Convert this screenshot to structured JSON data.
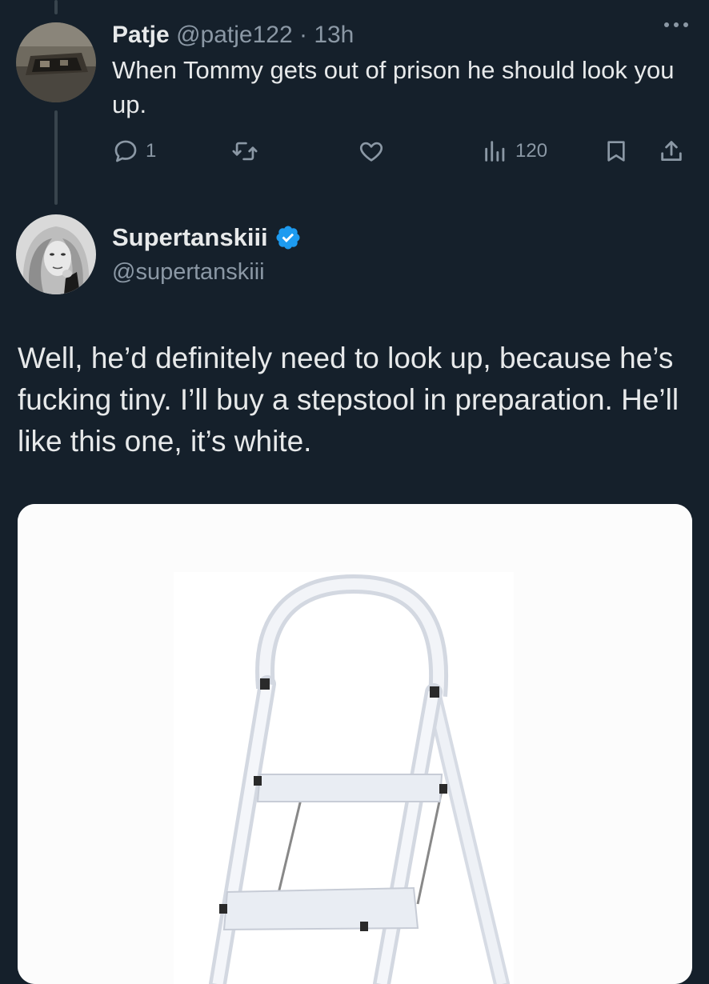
{
  "reply": {
    "display_name": "Patje",
    "handle": "@patje122",
    "separator": "·",
    "time": "13h",
    "text": "When Tommy gets out of prison he should look you up.",
    "reply_count": "1",
    "views": "120"
  },
  "tweet": {
    "display_name": "Supertanskiii",
    "handle": "@supertanskiii",
    "verified": true,
    "text": "Well, he’d definitely need to look up, because he’s fucking tiny. I’ll buy a stepstool in preparation. He’ll like this one, it’s white."
  },
  "icons": [
    "more-icon",
    "reply-icon",
    "retweet-icon",
    "like-icon",
    "views-icon",
    "bookmark-icon",
    "share-icon",
    "verified-badge-icon"
  ],
  "colors": {
    "background": "#15202b",
    "primary_text": "#e7e9ea",
    "secondary_text": "#8b98a5",
    "thread_line": "#38444d",
    "verified_blue": "#1d9bf0"
  }
}
